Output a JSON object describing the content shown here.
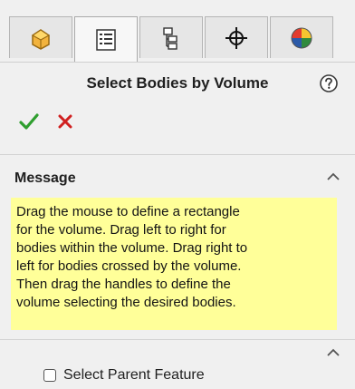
{
  "tabs": [
    {
      "icon": "feature-manager-icon",
      "active": false
    },
    {
      "icon": "property-manager-icon",
      "active": true
    },
    {
      "icon": "configuration-manager-icon",
      "active": false
    },
    {
      "icon": "dimxpert-manager-icon",
      "active": false
    },
    {
      "icon": "display-manager-icon",
      "active": false
    }
  ],
  "header": {
    "title": "Select Bodies by Volume",
    "help_icon": "help-question-icon"
  },
  "actions": {
    "ok_icon": "checkmark-icon",
    "cancel_icon": "close-icon"
  },
  "message_section": {
    "title": "Message",
    "collapse_icon": "chevron-up-icon",
    "lines": [
      "Drag the mouse to define a rectangle",
      "for the volume. Drag left to right for",
      "bodies within the volume. Drag right to",
      "left for bodies crossed by the volume.",
      "Then drag the handles to define the",
      "volume selecting the desired bodies."
    ]
  },
  "options_section": {
    "collapse_icon": "chevron-up-icon",
    "checkbox_label": "Select Parent Feature",
    "checked": false
  },
  "colors": {
    "background": "#f0f0f0",
    "message_background": "#ffff99",
    "ok_green": "#2e9e2e",
    "cancel_red": "#d02020"
  }
}
